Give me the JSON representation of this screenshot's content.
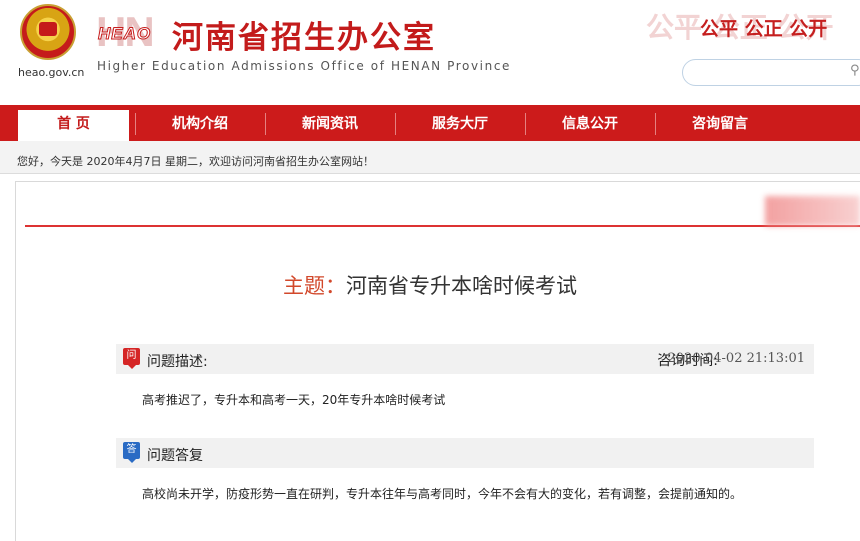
{
  "header": {
    "site_url": "heao.gov.cn",
    "logo_text": "HEAO",
    "logo_bg": "HN",
    "title": "河南省招生办公室",
    "subtitle": "Higher Education Admissions Office of HENAN Province",
    "slogan": "公平 公正 公开",
    "search_placeholder": ""
  },
  "nav": {
    "items": [
      {
        "label": "首 页",
        "active": true
      },
      {
        "label": "机构介绍"
      },
      {
        "label": "新闻资讯"
      },
      {
        "label": "服务大厅"
      },
      {
        "label": "信息公开"
      },
      {
        "label": "咨询留言"
      }
    ]
  },
  "welcome": {
    "text": "您好，今天是 2020年4月7日 星期二，欢迎访问河南省招生办公室网站！"
  },
  "topic": {
    "label": "主题：",
    "title": "河南省专升本啥时候考试"
  },
  "question": {
    "badge": "问",
    "heading": "问题描述:",
    "time_label": "咨询时间:",
    "time_value": "2020-04-02 21:13:01",
    "body": "高考推迟了，专升本和高考一天，20年专升本啥时候考试"
  },
  "answer": {
    "badge": "答",
    "heading": "问题答复",
    "body": "高校尚未开学，防疫形势一直在研判，专升本往年与高考同时，今年不会有大的变化，若有调整，会提前通知的。"
  },
  "colors": {
    "brand_red": "#cc1b1b",
    "topic_label": "#d2482b",
    "question_badge": "#d52525",
    "answer_badge": "#2a6bc4"
  }
}
